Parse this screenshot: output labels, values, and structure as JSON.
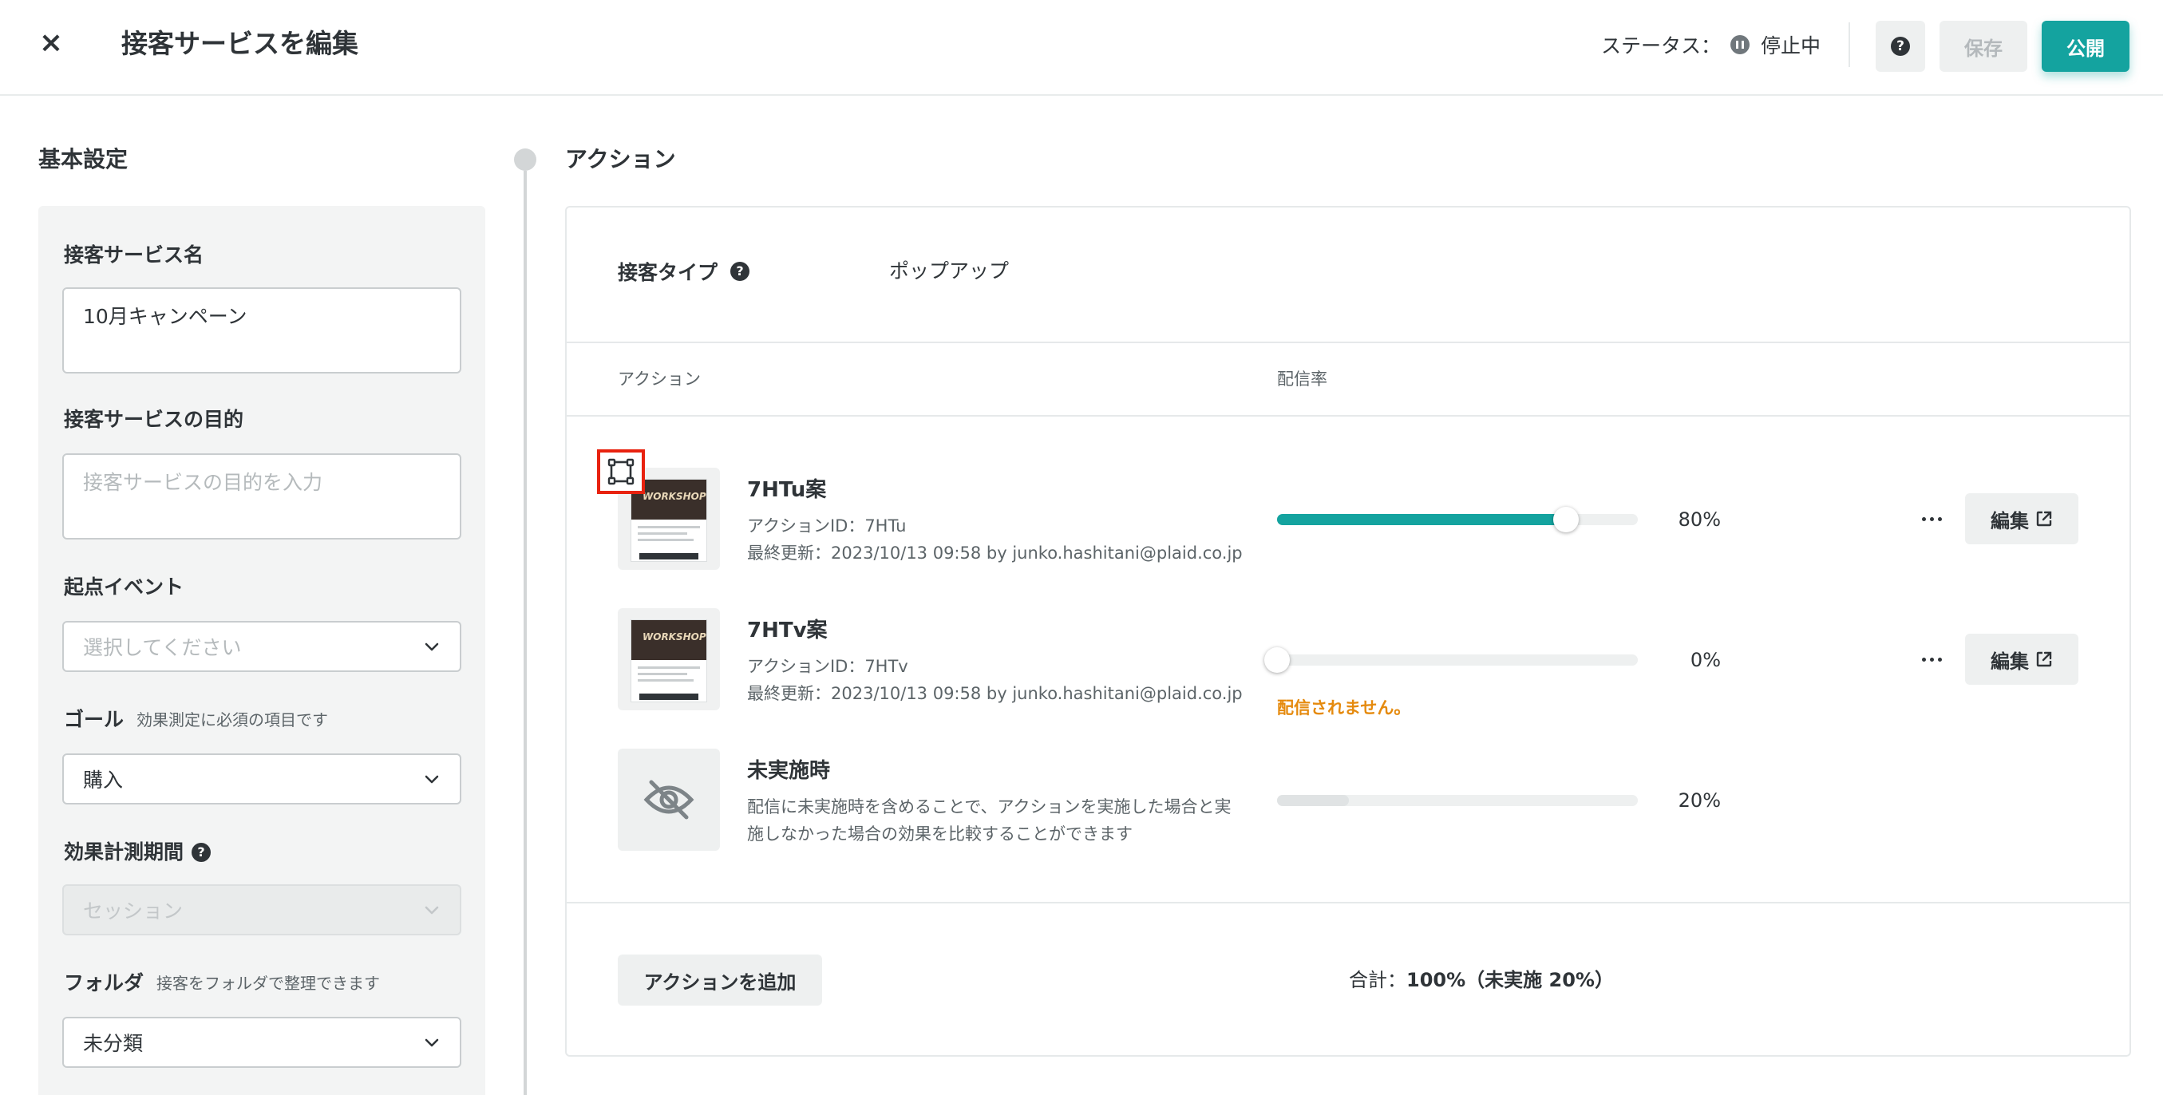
{
  "header": {
    "close_icon": "×",
    "title": "接客サービスを編集",
    "status_label": "ステータス：",
    "status_value": "停止中",
    "help_icon": "?",
    "save_label": "保存",
    "publish_label": "公開"
  },
  "left": {
    "section_title": "基本設定",
    "name_label": "接客サービス名",
    "name_value": "10月キャンペーン",
    "purpose_label": "接客サービスの目的",
    "purpose_placeholder": "接客サービスの目的を入力",
    "event_label": "起点イベント",
    "event_placeholder": "選択してください",
    "goal_label": "ゴール",
    "goal_hint": "効果測定に必須の項目です",
    "goal_value": "購入",
    "period_label": "効果計測期間",
    "period_value": "セッション",
    "folder_label": "フォルダ",
    "folder_hint": "接客をフォルダで整理できます",
    "folder_value": "未分類"
  },
  "right": {
    "section_title": "アクション",
    "type_label": "接客タイプ",
    "type_value": "ポップアップ",
    "col_action": "アクション",
    "col_rate": "配信率",
    "actions": [
      {
        "title": "7HTu案",
        "id_line": "アクションID：7HTu",
        "updated_line": "最終更新：2023/10/13 09:58 by junko.hashitani@plaid.co.jp",
        "rate": 80,
        "rate_label": "80%",
        "edit_label": "編集",
        "thumb_text": "WORKSHOP"
      },
      {
        "title": "7HTv案",
        "id_line": "アクションID：7HTv",
        "updated_line": "最終更新：2023/10/13 09:58 by junko.hashitani@plaid.co.jp",
        "rate": 0,
        "rate_label": "0%",
        "warning": "配信されません。",
        "edit_label": "編集",
        "thumb_text": "WORKSHOP"
      },
      {
        "title": "未実施時",
        "description": "配信に未実施時を含めることで、アクションを実施した場合と実施しなかった場合の効果を比較することができます",
        "rate": 20,
        "rate_label": "20%"
      }
    ],
    "add_label": "アクションを追加",
    "total_prefix": "合計：",
    "total_value": "100%（未実施 20%）"
  },
  "colors": {
    "accent": "#14a39f",
    "warning": "#e58a0e",
    "highlight": "#e8220f"
  },
  "icons": {
    "close": "close-icon",
    "pause": "pause-icon",
    "help": "help-icon",
    "chevron": "chevron-down-icon",
    "more": "more-horizontal-icon",
    "external": "external-link-icon",
    "hidden": "eye-off-icon",
    "select_frame": "frame-select-icon"
  }
}
